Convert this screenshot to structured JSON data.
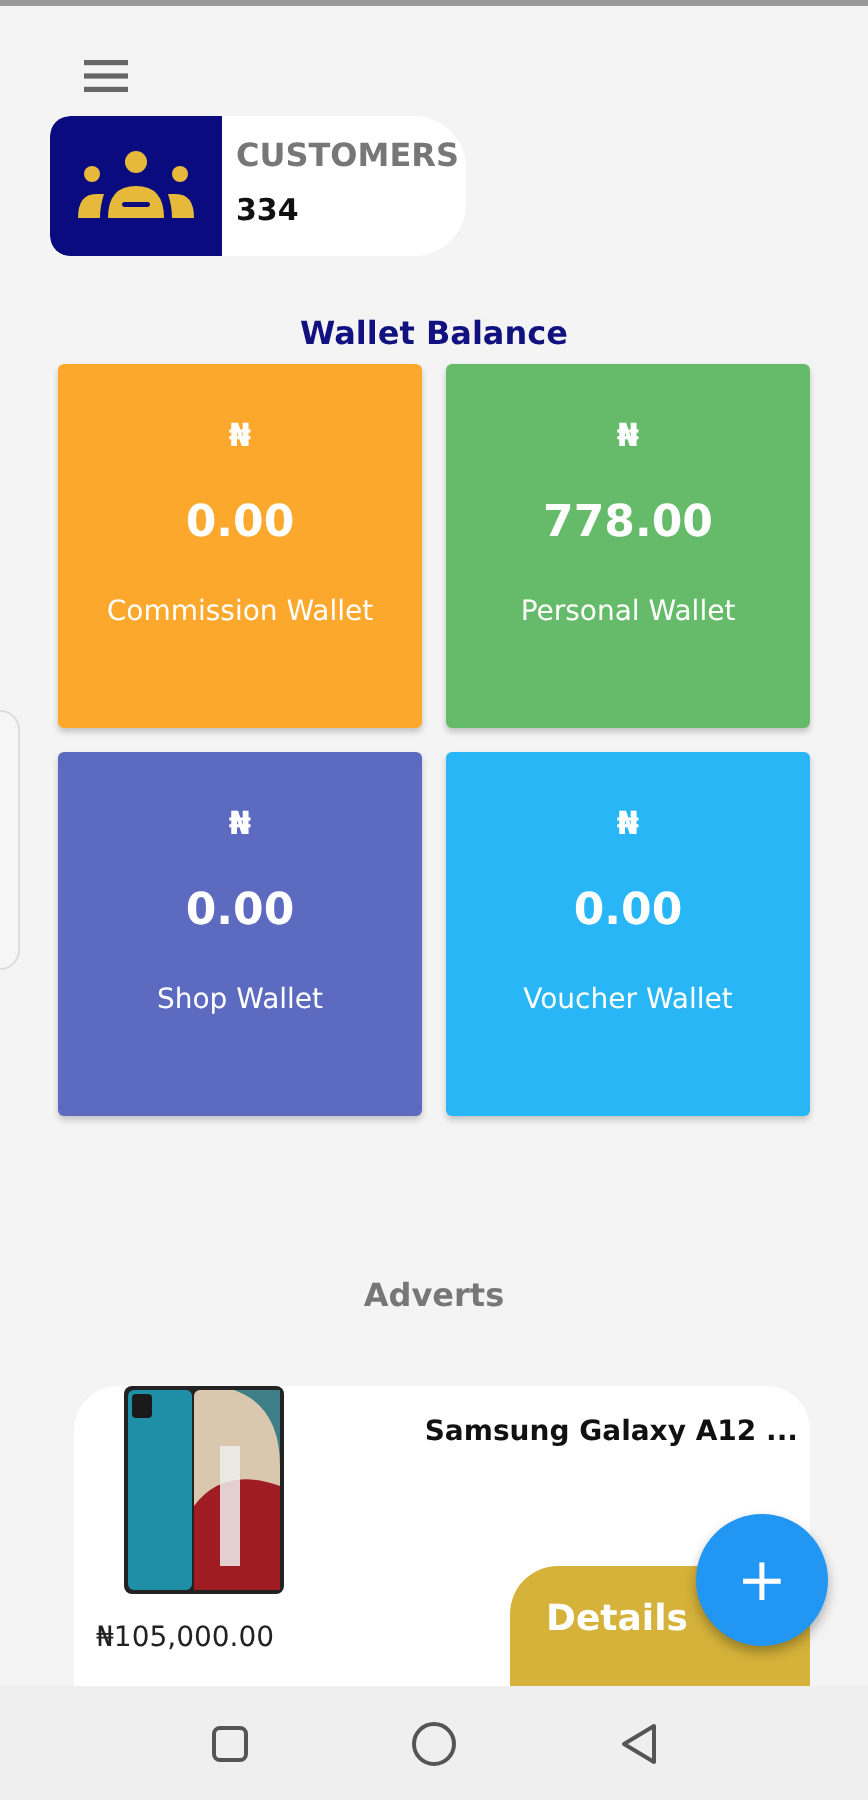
{
  "customers": {
    "label": "CUSTOMERS",
    "count": "334"
  },
  "wallet_balance": {
    "title": "Wallet Balance",
    "wallets": [
      {
        "currency": "₦",
        "amount": "0.00",
        "label": "Commission Wallet",
        "color": "#fba82c"
      },
      {
        "currency": "₦",
        "amount": "778.00",
        "label": "Personal Wallet",
        "color": "#66bb6a"
      },
      {
        "currency": "₦",
        "amount": "0.00",
        "label": "Shop Wallet",
        "color": "#5c6bc0"
      },
      {
        "currency": "₦",
        "amount": "0.00",
        "label": "Voucher Wallet",
        "color": "#29b6f6"
      }
    ]
  },
  "adverts": {
    "title": "Adverts",
    "items": [
      {
        "kind": "picture",
        "name": "Samsung Galaxy A12 ...",
        "price": "₦105,000.00",
        "button": "Details"
      }
    ]
  },
  "fab": "+"
}
